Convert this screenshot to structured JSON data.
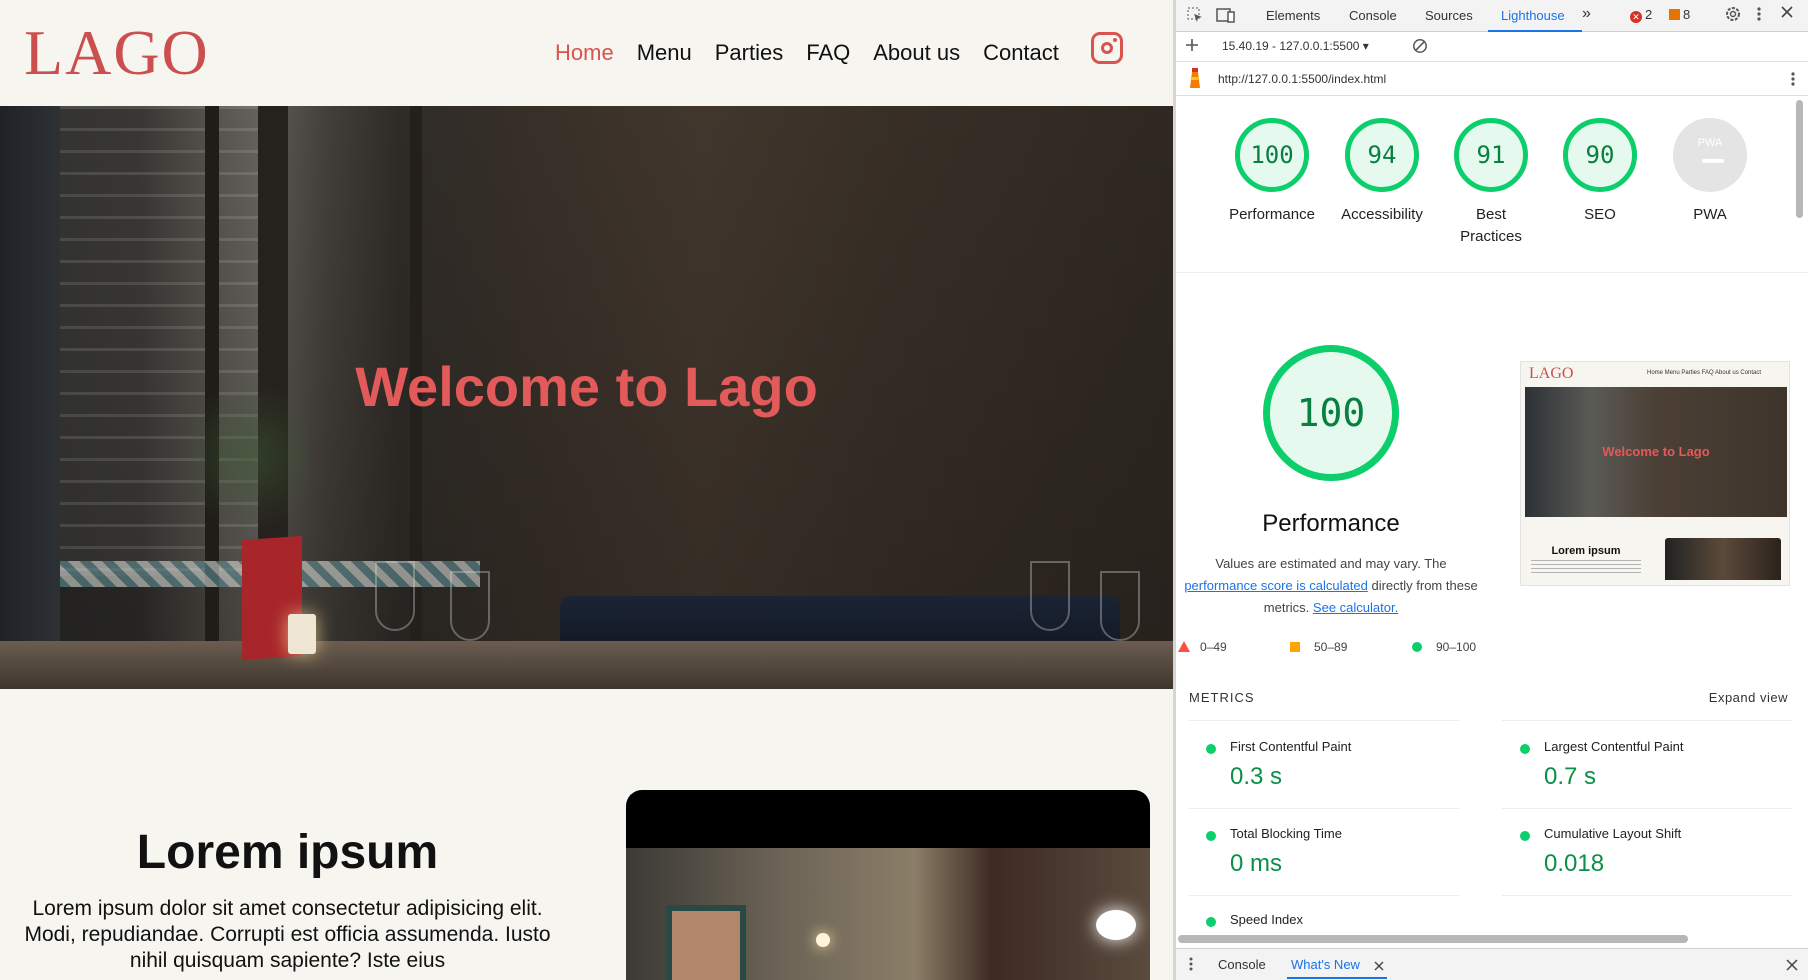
{
  "site": {
    "logo": "LAGO",
    "nav": [
      "Home",
      "Menu",
      "Parties",
      "FAQ",
      "About us",
      "Contact"
    ],
    "active_nav": "Home",
    "hero_title": "Welcome to Lago",
    "about_heading": "Lorem ipsum",
    "about_text": "Lorem ipsum dolor sit amet consectetur adipisicing elit. Modi, repudiandae. Corrupti est officia assumenda. Iusto nihil quisquam sapiente? Iste eius",
    "accent_color": "#d9534f"
  },
  "devtools": {
    "tabs": [
      "Elements",
      "Console",
      "Sources",
      "Lighthouse"
    ],
    "active_tab": "Lighthouse",
    "more_tabs": "»",
    "errors": "2",
    "warnings": "8",
    "report_selector": "15.40.19 - 127.0.0.1:5500 ▾",
    "url": "http://127.0.0.1:5500/index.html",
    "scores": [
      {
        "label": "Performance",
        "value": "100"
      },
      {
        "label": "Accessibility",
        "value": "94"
      },
      {
        "label": "Best Practices",
        "value": "91"
      },
      {
        "label": "SEO",
        "value": "90"
      },
      {
        "label": "PWA",
        "value": "PWA"
      }
    ],
    "performance": {
      "score": "100",
      "label": "Performance",
      "desc_pre": "Values are estimated and may vary. The",
      "desc_link1": "performance score is calculated",
      "desc_mid": "directly from these metrics.",
      "desc_link2": "See calculator."
    },
    "legend": {
      "low": "0–49",
      "mid": "50–89",
      "high": "90–100"
    },
    "thumb": {
      "logo": "LAGO",
      "nav": "Home  Menu  Parties  FAQ  About us  Contact",
      "title": "Welcome to Lago",
      "subtitle": "Lorem ipsum"
    },
    "metrics_heading": "METRICS",
    "expand_view": "Expand view",
    "metrics": [
      {
        "name": "First Contentful Paint",
        "value": "0.3 s"
      },
      {
        "name": "Largest Contentful Paint",
        "value": "0.7 s"
      },
      {
        "name": "Total Blocking Time",
        "value": "0 ms"
      },
      {
        "name": "Cumulative Layout Shift",
        "value": "0.018"
      },
      {
        "name": "Speed Index",
        "value": ""
      }
    ],
    "drawer_tabs": [
      "Console",
      "What's New"
    ],
    "active_drawer_tab": "What's New",
    "pass_color": "#0cce6b"
  }
}
